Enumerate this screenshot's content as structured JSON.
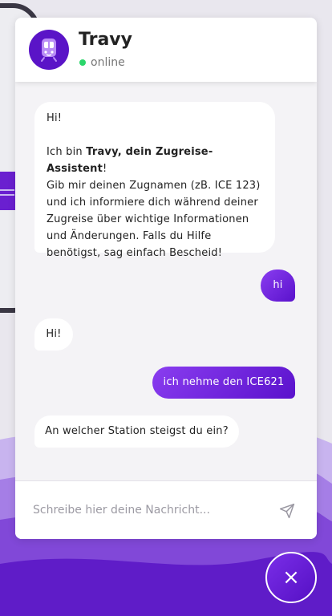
{
  "header": {
    "bot_name": "Travy",
    "status": "online",
    "status_color": "#2bd66b",
    "avatar_icon": "train-icon"
  },
  "messages": [
    {
      "sender": "bot",
      "greeting": "Hi!",
      "intro_before": "Ich bin ",
      "intro_bold": "Travy, dein Zugreise-Assistent",
      "intro_after": "!",
      "body": "Gib mir deinen Zugnamen (zB. ICE 123) und ich informiere dich während deiner Zugreise über wichtige Informationen und Änderungen. Falls du Hilfe benötigst, sag einfach Bescheid!"
    },
    {
      "sender": "user",
      "text": "hi"
    },
    {
      "sender": "bot",
      "text": "Hi!"
    },
    {
      "sender": "user",
      "text": "ich nehme den ICE621"
    },
    {
      "sender": "bot",
      "text": "An welcher Station steigst du ein?"
    }
  ],
  "composer": {
    "placeholder": "Schreibe hier deine Nachricht...",
    "send_icon": "send-icon"
  },
  "fab": {
    "icon": "close-icon",
    "label": "×"
  },
  "colors": {
    "accent": "#6a1fd0",
    "user_bubble_start": "#8a3df0",
    "user_bubble_end": "#5a12cc"
  }
}
